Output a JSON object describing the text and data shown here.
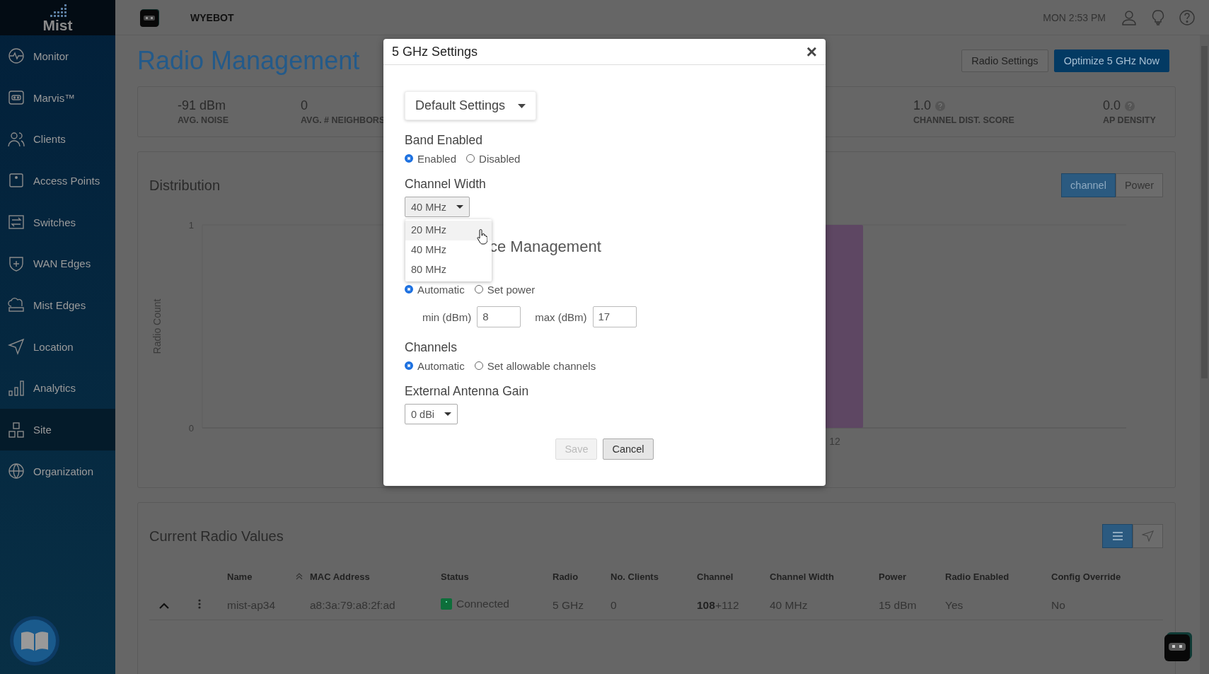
{
  "sidebar": {
    "logo": "Mist",
    "items": [
      {
        "label": "Monitor",
        "selected": false
      },
      {
        "label": "Marvis™",
        "selected": false
      },
      {
        "label": "Clients",
        "selected": false
      },
      {
        "label": "Access Points",
        "selected": false
      },
      {
        "label": "Switches",
        "selected": false
      },
      {
        "label": "WAN Edges",
        "selected": false
      },
      {
        "label": "Mist Edges",
        "selected": false
      },
      {
        "label": "Location",
        "selected": false
      },
      {
        "label": "Analytics",
        "selected": false
      },
      {
        "label": "Site",
        "selected": true
      },
      {
        "label": "Organization",
        "selected": false
      }
    ]
  },
  "header": {
    "org": "WYEBOT",
    "time": "MON 2:53 PM"
  },
  "page": {
    "title": "Radio Management",
    "actions": [
      {
        "label": "Radio Settings",
        "kind": "secondary"
      },
      {
        "label": "Optimize 5 GHz Now",
        "kind": "primary"
      }
    ]
  },
  "stats": [
    {
      "value": "-91 dBm",
      "label": "AVG. NOISE",
      "help": false
    },
    {
      "value": "0",
      "label": "AVG. # NEIGHBORS",
      "help": false
    },
    {
      "value": "1.0",
      "label": "CHANNEL DIST. SCORE",
      "help": true
    },
    {
      "value": "0.0",
      "label": "AP DENSITY",
      "help": true
    }
  ],
  "distribution": {
    "title": "Distribution",
    "toggle": [
      {
        "label": "channel",
        "selected": true
      },
      {
        "label": "Power",
        "selected": false
      }
    ],
    "chart_data": {
      "type": "bar",
      "ylabel": "Radio Count",
      "categories": [
        "12"
      ],
      "ylim": [
        0,
        1
      ],
      "yticks": [
        0,
        1
      ],
      "series": [
        {
          "color": "#5e4763",
          "values": [
            1
          ]
        }
      ]
    }
  },
  "radio_values": {
    "title": "Current Radio Values",
    "views": [
      {
        "kind": "list",
        "selected": true
      },
      {
        "kind": "map",
        "selected": false
      }
    ],
    "columns": [
      {
        "label": "Name",
        "sorted": true
      },
      {
        "label": "MAC Address",
        "sorted": false
      },
      {
        "label": "Status",
        "sorted": false,
        "kind": "status"
      },
      {
        "label": "Radio",
        "sorted": false
      },
      {
        "label": "No. Clients",
        "sorted": false
      },
      {
        "label": "Channel",
        "sorted": false
      },
      {
        "label": "Channel Width",
        "sorted": false
      },
      {
        "label": "Power",
        "sorted": false
      },
      {
        "label": "Radio Enabled",
        "sorted": false
      },
      {
        "label": "Config Override",
        "sorted": false
      }
    ],
    "rows": [
      {
        "expanded": true,
        "cells": [
          "mist-ap34",
          "a8:3a:79:a8:2f:ad",
          "Connected",
          "5 GHz",
          "0",
          "**108**+112",
          "40 MHz",
          "15 dBm",
          "Yes",
          "No"
        ]
      }
    ]
  },
  "modal": {
    "title": "5 GHz Settings",
    "close": "×",
    "preset": "Default Settings",
    "sections": [
      {
        "kind": "radios",
        "label": "Band Enabled",
        "options": [
          {
            "label": "Enabled",
            "selected": true
          },
          {
            "label": "Disabled",
            "selected": false
          }
        ]
      },
      {
        "kind": "select",
        "label": "Channel Width",
        "value": "40 MHz",
        "menu": [
          {
            "label": "20 MHz",
            "hovered": true
          },
          {
            "label": "40 MHz",
            "hovered": false
          },
          {
            "label": "80 MHz",
            "hovered": false
          }
        ]
      },
      {
        "kind": "power",
        "label": "ce Management",
        "options": [
          {
            "label": "Automatic",
            "selected": true
          },
          {
            "label": "Set power",
            "selected": false
          }
        ],
        "fields": [
          {
            "label": "min (dBm)",
            "value": "8"
          },
          {
            "label": "max (dBm)",
            "value": "17"
          }
        ]
      },
      {
        "kind": "radios",
        "label": "Channels",
        "options": [
          {
            "label": "Automatic",
            "selected": true
          },
          {
            "label": "Set allowable channels",
            "selected": false
          }
        ]
      },
      {
        "kind": "select",
        "label": "External Antenna Gain",
        "value": "0 dBi"
      }
    ],
    "buttons": [
      {
        "label": "Save",
        "disabled": true
      },
      {
        "label": "Cancel",
        "disabled": false
      }
    ]
  }
}
